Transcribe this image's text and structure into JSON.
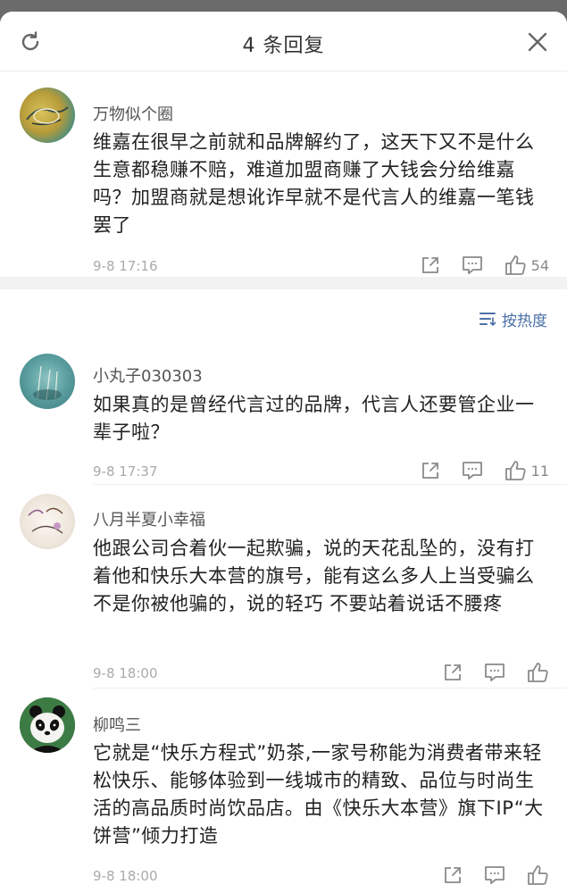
{
  "header": {
    "title": "4 条回复"
  },
  "main_comment": {
    "user": "万物似个圈",
    "text": "维嘉在很早之前就和品牌解约了，这天下又不是什么生意都稳赚不赔，难道加盟商赚了大钱会分给维嘉吗？加盟商就是想讹诈早就不是代言人的维嘉一笔钱罢了",
    "time": "9-8 17:16",
    "likes": "54"
  },
  "sort": {
    "label": "按热度"
  },
  "replies": [
    {
      "user": "小丸子030303",
      "text": "如果真的是曾经代言过的品牌，代言人还要管企业一辈子啦？",
      "time": "9-8 17:37",
      "likes": "11"
    },
    {
      "user": "八月半夏小幸福",
      "text": "他跟公司合着伙一起欺骗，说的天花乱坠的，没有打着他和快乐大本营的旗号，能有这么多人上当受骗么 不是你被他骗的，说的轻巧 不要站着说话不腰疼",
      "time": "9-8 18:00",
      "likes": ""
    },
    {
      "user": "柳鸣三",
      "text": "它就是“快乐方程式”奶茶,一家号称能为消费者带来轻松快乐、能够体验到一线城市的精致、品位与时尚生活的高品质时尚饮品店。由《快乐大本营》旗下IP“大饼营”倾力打造",
      "time": "9-8 18:00",
      "likes": ""
    }
  ],
  "icons": {
    "refresh": "refresh-icon",
    "close": "close-icon",
    "share": "share-icon",
    "comment": "comment-icon",
    "like": "thumbs-up-icon",
    "sort": "sort-icon"
  },
  "colors": {
    "backdrop": "#6b6b6b",
    "sort_link": "#4a6fa5",
    "divider_band": "#f2f2f2"
  }
}
